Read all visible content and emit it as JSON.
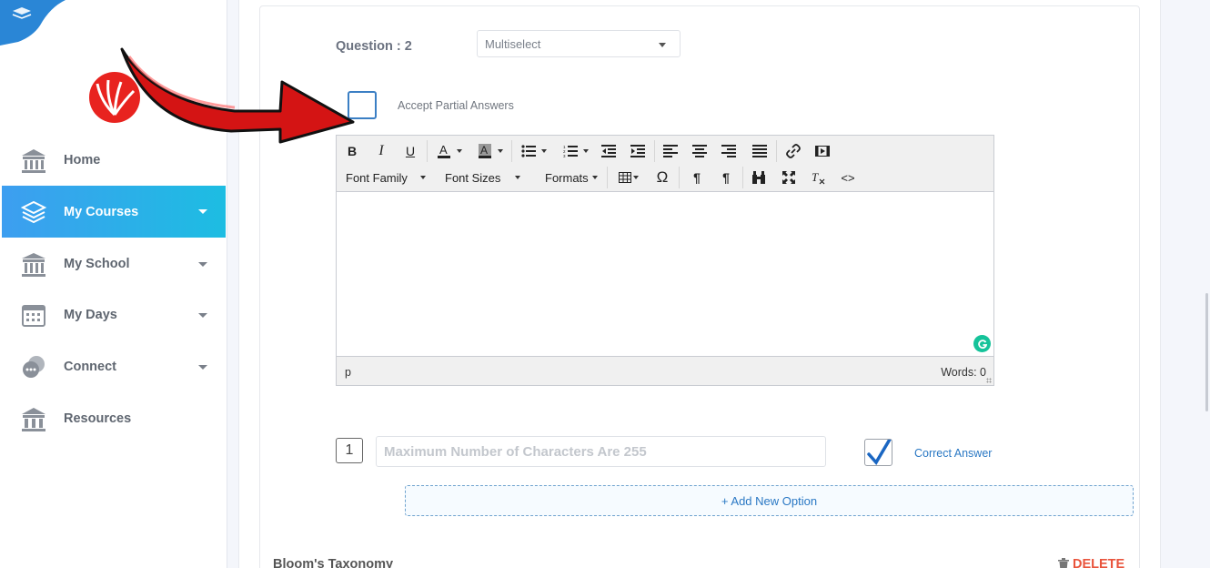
{
  "sidebar": {
    "items": [
      {
        "label": "Home",
        "icon": "home-building-icon",
        "has_caret": false,
        "active": false
      },
      {
        "label": "My Courses",
        "icon": "stacked-layers-icon",
        "has_caret": true,
        "active": true
      },
      {
        "label": "My School",
        "icon": "school-building-icon",
        "has_caret": true,
        "active": false
      },
      {
        "label": "My Days",
        "icon": "calendar-icon",
        "has_caret": true,
        "active": false
      },
      {
        "label": "Connect",
        "icon": "chat-bubbles-icon",
        "has_caret": true,
        "active": false
      },
      {
        "label": "Resources",
        "icon": "resources-building-icon",
        "has_caret": false,
        "active": false
      }
    ]
  },
  "question": {
    "label": "Question : 2",
    "type_value": "Multiselect",
    "partial_label": "Accept Partial Answers",
    "partial_checked": false
  },
  "editor": {
    "font_family_label": "Font Family",
    "font_sizes_label": "Font Sizes",
    "formats_label": "Formats",
    "status_path": "p",
    "word_count": "Words: 0"
  },
  "option": {
    "number": "1",
    "placeholder": "Maximum Number of Characters Are 255",
    "correct_label": "Correct Answer",
    "correct_checked": true,
    "add_label": "+ Add New Option"
  },
  "footer": {
    "bloom_label": "Bloom's Taxonomy",
    "delete_label": "DELETE"
  },
  "colors": {
    "accent": "#3d9ef0",
    "accent_end": "#1dbde2",
    "link": "#2a78c4",
    "delete": "#e9543c",
    "arrow": "#d41414"
  }
}
